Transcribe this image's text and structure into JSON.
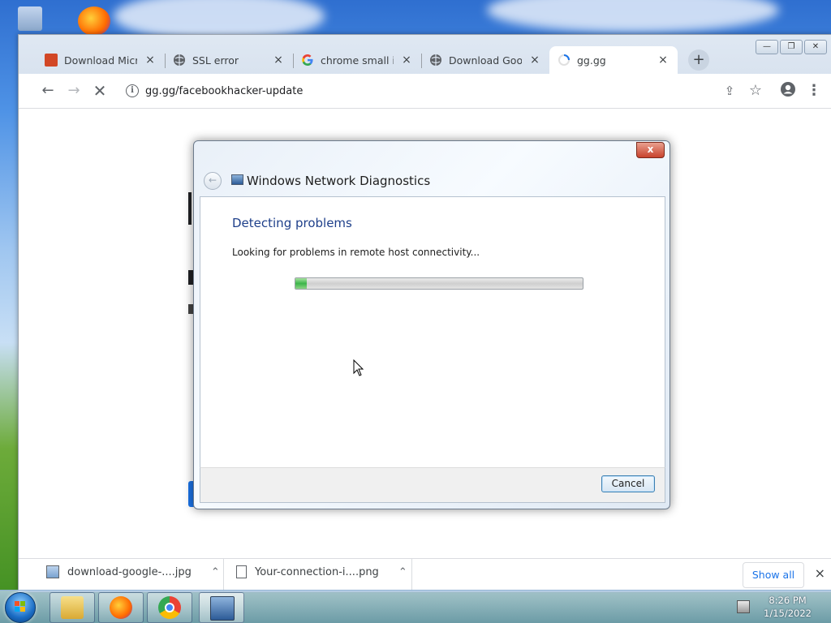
{
  "browser": {
    "tabs": [
      {
        "title": "Download Micros",
        "favicon": "powerpoint-icon",
        "active": false
      },
      {
        "title": "SSL error",
        "favicon": "globe-icon",
        "active": false
      },
      {
        "title": "chrome small ico",
        "favicon": "google-icon",
        "active": false
      },
      {
        "title": "Download Googl",
        "favicon": "globe-icon",
        "active": false
      },
      {
        "title": "gg.gg",
        "favicon": "loading-spinner-icon",
        "active": true
      }
    ],
    "new_tab_label": "+",
    "close_glyph": "×",
    "address": "gg.gg/facebookhacker-update",
    "info_glyph": "i"
  },
  "dialog": {
    "title": "Windows Network Diagnostics",
    "heading": "Detecting problems",
    "status": "Looking for problems in remote host connectivity...",
    "progress_percent": 4,
    "cancel_label": "Cancel",
    "close_glyph": "x"
  },
  "downloads": {
    "items": [
      {
        "name": "download-google-....jpg",
        "icon": "image-file-icon"
      },
      {
        "name": "Your-connection-i....png",
        "icon": "file-icon"
      }
    ],
    "show_all_label": "Show all",
    "close_glyph": "×"
  },
  "taskbar": {
    "apps": [
      "file-explorer-icon",
      "firefox-icon",
      "chrome-icon",
      "network-diagnostics-icon"
    ],
    "time": "8:26 PM",
    "date": "1/15/2022"
  }
}
